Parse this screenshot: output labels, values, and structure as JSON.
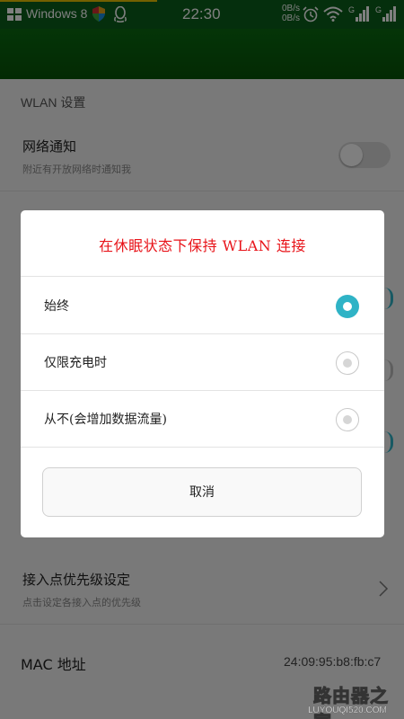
{
  "status_bar": {
    "carrier": "Windows 8",
    "time": "22:30",
    "speed_up": "0B/s",
    "speed_down": "0B/s",
    "icons": [
      "windows-logo-icon",
      "shield-icon",
      "qq-icon",
      "alarm-icon",
      "wifi-icon",
      "signal-icon",
      "signal-icon"
    ]
  },
  "settings": {
    "section_title": "WLAN 设置",
    "network_notify": {
      "title": "网络通知",
      "subtitle": "附近有开放网络时通知我",
      "toggle_on": false
    },
    "ap_priority": {
      "title": "接入点优先级设定",
      "subtitle": "点击设定各接入点的优先级"
    },
    "mac": {
      "label": "MAC 地址",
      "value": "24:09:95:b8:fb:c7"
    }
  },
  "dialog": {
    "title": "在休眠状态下保持 WLAN 连接",
    "options": [
      {
        "label": "始终",
        "selected": true
      },
      {
        "label": "仅限充电时",
        "selected": false
      },
      {
        "label": "从不(会增加数据流量)",
        "selected": false
      }
    ],
    "cancel_label": "取消"
  },
  "watermark": {
    "main": "路由器之家",
    "url": "LUYOUQI520.COM"
  },
  "colors": {
    "status_bar": "#0a5f1a",
    "accent": "#2fb3c6",
    "dialog_title": "#e8141a"
  }
}
